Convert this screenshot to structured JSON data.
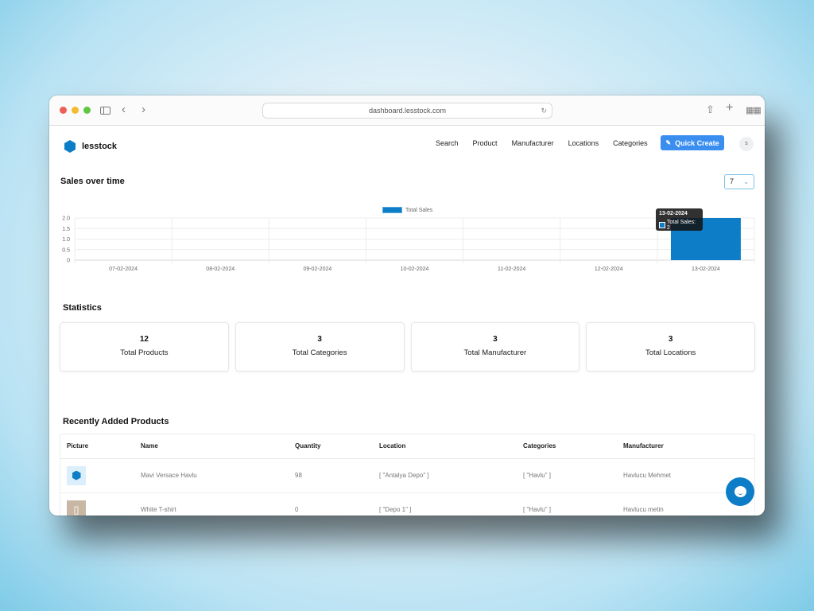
{
  "browser": {
    "url": "dashboard.lesstock.com",
    "icons": [
      "sidebar-icon",
      "back-icon",
      "forward-icon",
      "reload-icon",
      "share-icon",
      "new-tab-icon",
      "tab-overview-icon"
    ]
  },
  "app": {
    "name": "lesstock",
    "brand_color": "#0e7dc7",
    "accent_color": "#3a8ef0"
  },
  "nav": {
    "links": [
      "Search",
      "Product",
      "Manufacturer",
      "Locations",
      "Categories"
    ],
    "quick_create": "Quick Create",
    "avatar_initial": "s"
  },
  "sales": {
    "title": "Sales over time",
    "range_value": "7",
    "tooltip": {
      "title": "13-02-2024",
      "label": "Total Sales: 2"
    }
  },
  "chart_data": {
    "type": "bar",
    "title": "Sales over time",
    "categories": [
      "07-02-2024",
      "08-02-2024",
      "09-02-2024",
      "10-02-2024",
      "11-02-2024",
      "12-02-2024",
      "13-02-2024"
    ],
    "series": [
      {
        "name": "Total Sales",
        "values": [
          0,
          0,
          0,
          0,
          0,
          0,
          2
        ],
        "color": "#0e7dc7"
      }
    ],
    "yticks": [
      "0",
      "0.5",
      "1.0",
      "1.5",
      "2.0"
    ],
    "ylim": [
      0,
      2
    ],
    "xlabel": "",
    "ylabel": "",
    "grid": true,
    "legend": "top-center"
  },
  "statistics": {
    "title": "Statistics",
    "cards": [
      {
        "value": "12",
        "label": "Total Products"
      },
      {
        "value": "3",
        "label": "Total Categories"
      },
      {
        "value": "3",
        "label": "Total Manufacturer"
      },
      {
        "value": "3",
        "label": "Total Locations"
      }
    ]
  },
  "recent": {
    "title": "Recently Added Products",
    "columns": [
      "Picture",
      "Name",
      "Quantity",
      "Location",
      "Categories",
      "Manufacturer"
    ],
    "rows": [
      {
        "picture": "hexagon-logo-image",
        "name": "Mavi Versace Havlu",
        "quantity": "98",
        "location": "[ \"Antalya Depo\" ]",
        "categories": "[ \"Havlu\" ]",
        "manufacturer": "Havlucu Mehmet"
      },
      {
        "picture": "white-tshirt-image",
        "name": "White T-shirt",
        "quantity": "0",
        "location": "[ \"Depo 1\" ]",
        "categories": "[ \"Havlu\" ]",
        "manufacturer": "Havlucu metin"
      }
    ]
  }
}
